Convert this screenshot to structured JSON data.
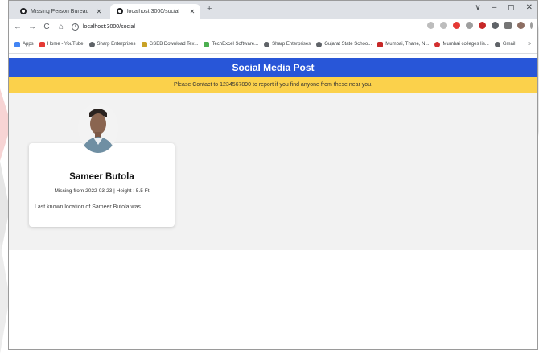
{
  "browser": {
    "tabs": [
      {
        "title": "Missing Person Bureau",
        "active": false
      },
      {
        "title": "localhost:3000/social",
        "active": true
      }
    ],
    "new_tab": "+",
    "window_controls": [
      "∨",
      "–",
      "◻",
      "✕"
    ],
    "url": "localhost:3000/social",
    "bookmarks": [
      {
        "label": "Apps",
        "icon": "apps-grid-icon",
        "color": "#4285f4"
      },
      {
        "label": "Home - YouTube",
        "icon": "youtube-icon",
        "color": "#e53935"
      },
      {
        "label": "Sharp Enterprises",
        "icon": "globe-icon",
        "color": "#5f6368"
      },
      {
        "label": "GSEB Download Tex...",
        "icon": "book-icon",
        "color": "#c9a227"
      },
      {
        "label": "TechExcel Software...",
        "icon": "chart-icon",
        "color": "#4caf50"
      },
      {
        "label": "Sharp Enterprises",
        "icon": "globe-icon",
        "color": "#5f6368"
      },
      {
        "label": "Gujarat State Schoo...",
        "icon": "globe-icon",
        "color": "#5f6368"
      },
      {
        "label": "Mumbai, Thane, N...",
        "icon": "red-square-icon",
        "color": "#c62828"
      },
      {
        "label": "Mumbai colleges lis...",
        "icon": "red-circle-icon",
        "color": "#d32f2f"
      },
      {
        "label": "Gmail",
        "icon": "globe-icon",
        "color": "#5f6368"
      }
    ],
    "bookmarks_more": "»"
  },
  "page": {
    "title": "Social Media Post",
    "notice": "Please Contact to 1234567890 to report if you find anyone from these near you.",
    "header_color": "#2856d8",
    "notice_color": "#fbd14b"
  },
  "person": {
    "name": "Sameer Butola",
    "meta": "Missing from 2022-03-23 | Height : 5.5 Ft",
    "description": "Last known location of Sameer Butola was"
  }
}
